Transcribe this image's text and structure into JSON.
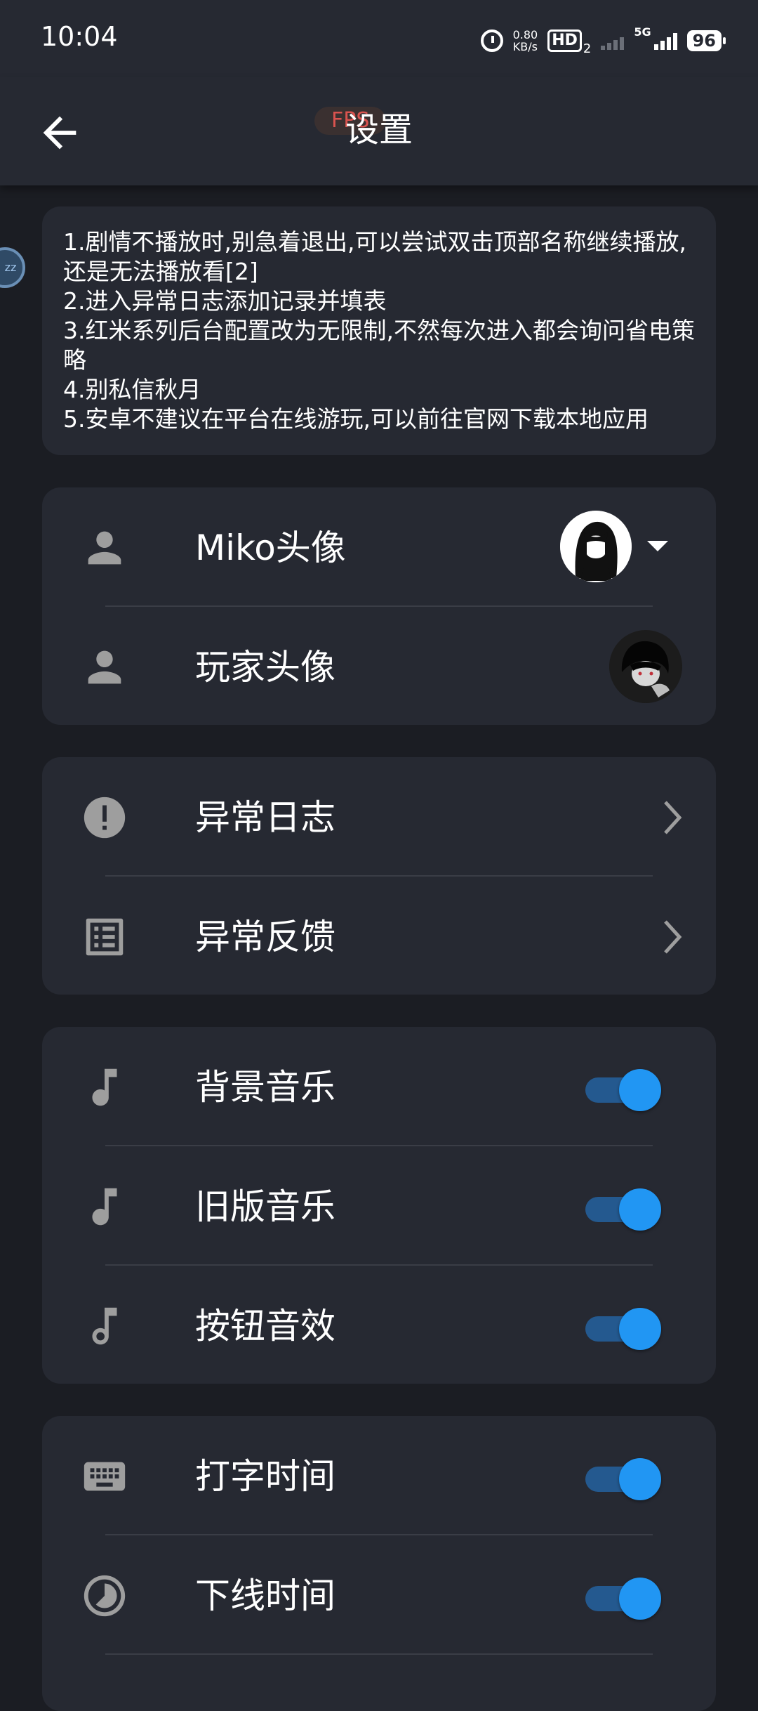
{
  "status_bar": {
    "time": "10:04",
    "net_speed_value": "0.80",
    "net_speed_unit": "KB/s",
    "hd_label": "HD",
    "hd_sub": "2",
    "network_label": "5G",
    "battery": "96"
  },
  "header": {
    "fps_label": "FPS",
    "title": "设置"
  },
  "floating_bubble": {
    "text": "zz"
  },
  "notice": {
    "lines": [
      "1.剧情不播放时,别急着退出,可以尝试双击顶部名称继续播放,还是无法播放看[2]",
      "2.进入异常日志添加记录并填表",
      "3.红米系列后台配置改为无限制,不然每次进入都会询问省电策略",
      "4.别私信秋月",
      "5.安卓不建议在平台在线游玩,可以前往官网下载本地应用"
    ]
  },
  "avatar_card": {
    "miko_label": "Miko头像",
    "player_label": "玩家头像"
  },
  "log_card": {
    "error_log_label": "异常日志",
    "error_feedback_label": "异常反馈"
  },
  "audio_card": {
    "bgm_label": "背景音乐",
    "bgm_on": true,
    "old_music_label": "旧版音乐",
    "old_music_on": true,
    "button_sfx_label": "按钮音效",
    "button_sfx_on": true
  },
  "time_card": {
    "typing_time_label": "打字时间",
    "typing_time_on": true,
    "offline_time_label": "下线时间",
    "offline_time_on": true
  },
  "colors": {
    "background": "#1b1d23",
    "card": "#262932",
    "accent": "#2196f3",
    "toggle_track": "#24598f",
    "icon_gray": "#9e9e9e",
    "fps_text": "#d9534f"
  },
  "icons": {
    "back": "arrow-left-icon",
    "miko_avatar_row": "person-icon",
    "player_avatar_row": "person-icon",
    "error_log": "alert-circle-icon",
    "error_feedback": "list-box-icon",
    "bgm": "music-note-icon",
    "old_music": "music-note-icon",
    "button_sfx": "music-note-icon",
    "typing_time": "keyboard-icon",
    "offline_time": "timelapse-icon"
  }
}
